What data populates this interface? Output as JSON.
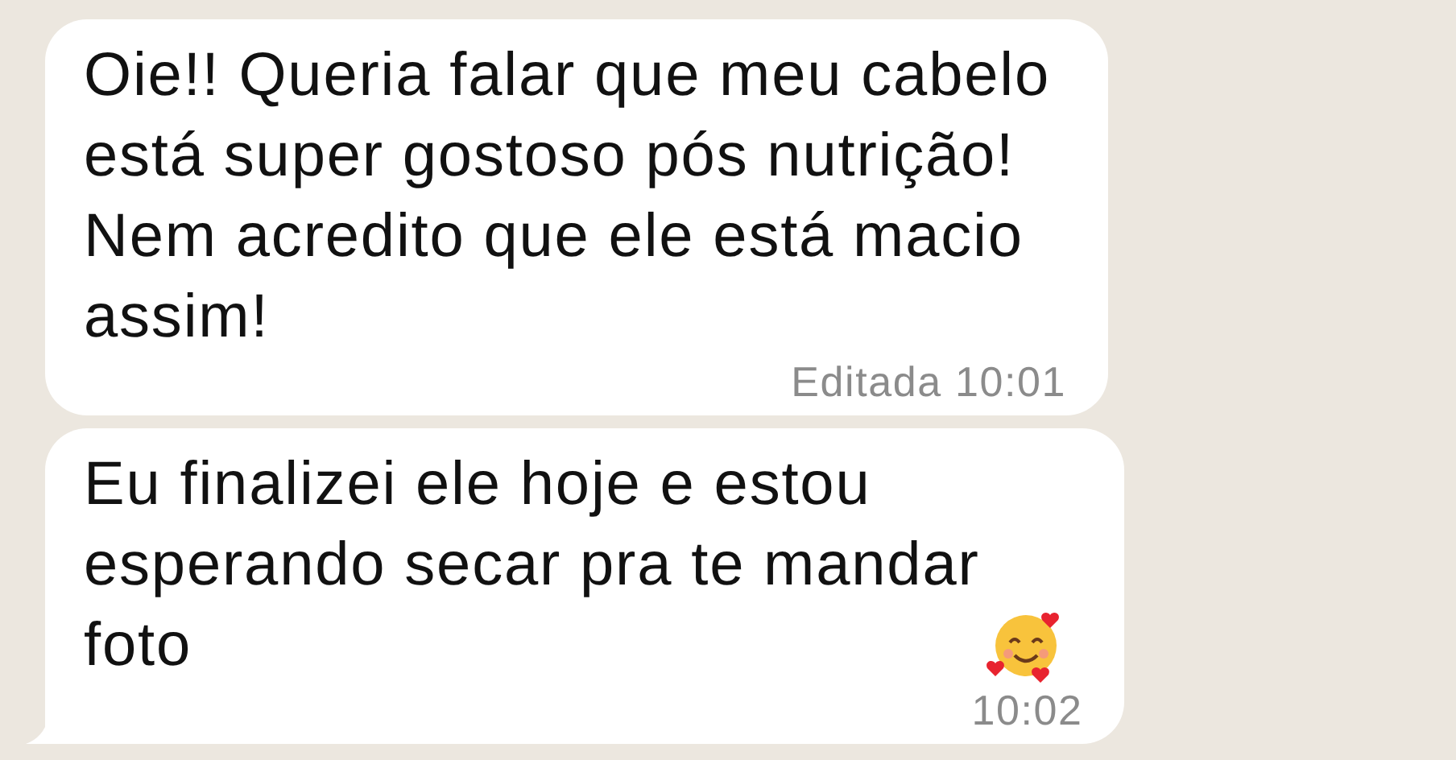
{
  "messages": [
    {
      "text": "Oie!! Queria falar que meu cabelo\nestá super gostoso pós nutrição!\nNem acredito que ele está macio\nassim!",
      "edited_label": "Editada",
      "time": "10:01",
      "tail": false
    },
    {
      "text": "Eu finalizei ele hoje e estou\nesperando secar pra te mandar\nfoto",
      "emoji": true,
      "time": "10:02",
      "tail": true
    }
  ]
}
